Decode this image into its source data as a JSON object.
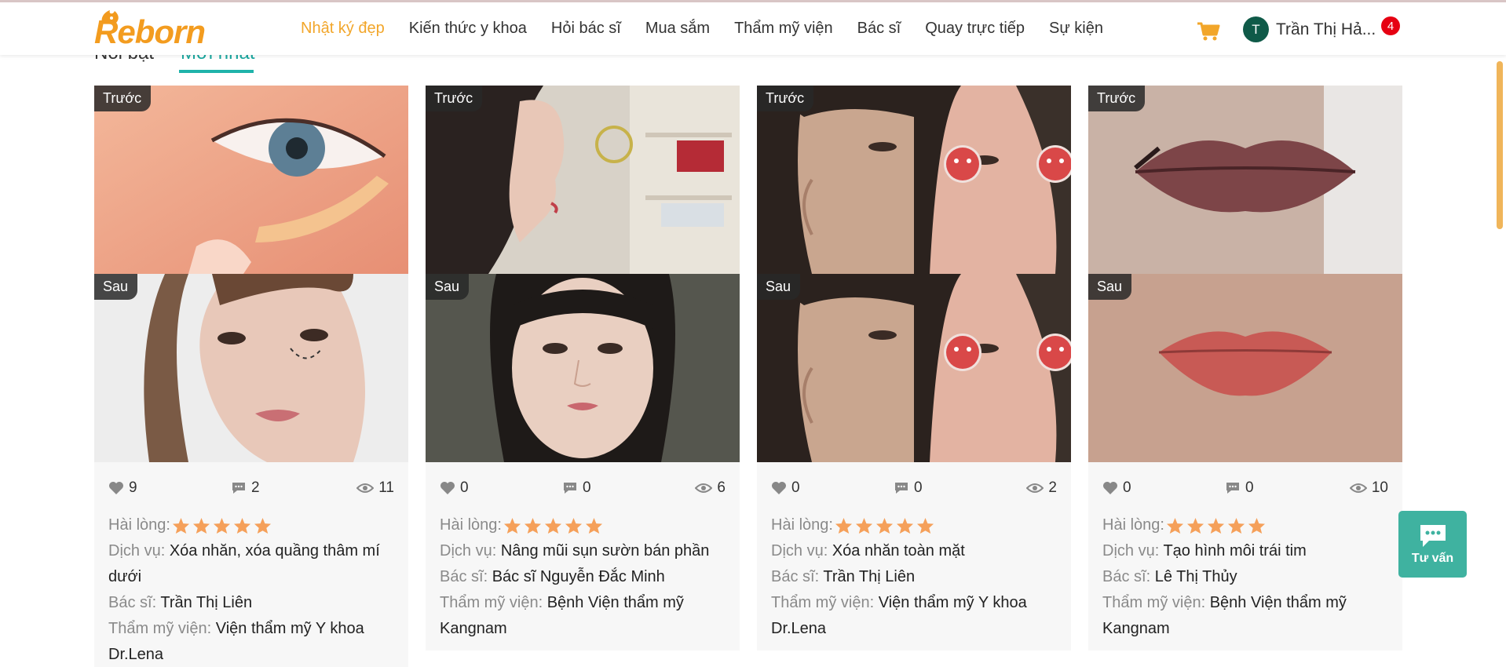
{
  "header": {
    "logo_text": "Reborn",
    "nav": [
      {
        "label": "Nhật ký đẹp",
        "active": true
      },
      {
        "label": "Kiến thức y khoa",
        "active": false
      },
      {
        "label": "Hỏi bác sĩ",
        "active": false
      },
      {
        "label": "Mua sắm",
        "active": false
      },
      {
        "label": "Thẩm mỹ viện",
        "active": false
      },
      {
        "label": "Bác sĩ",
        "active": false
      },
      {
        "label": "Quay trực tiếp",
        "active": false
      },
      {
        "label": "Sự kiện",
        "active": false
      }
    ],
    "cart_icon": "cart-icon",
    "user": {
      "initial": "T",
      "name": "Trần Thị Hả...",
      "notification_count": "4"
    }
  },
  "tabs": [
    {
      "label": "Nổi bật",
      "active": false
    },
    {
      "label": "Mới nhất",
      "active": true
    }
  ],
  "labels": {
    "before": "Trước",
    "after": "Sau",
    "satisfaction": "Hài lòng:",
    "service": "Dịch vụ:",
    "doctor": "Bác sĩ:",
    "clinic": "Thẩm mỹ viện:"
  },
  "cards": [
    {
      "likes": "9",
      "comments": "2",
      "views": "11",
      "rating": 5,
      "service": "Xóa nhăn, xóa quầng thâm mí dưới",
      "doctor": "Trần Thị Liên",
      "clinic": "Viện thẩm mỹ Y khoa Dr.Lena",
      "before_image": "eye-concealer-photo",
      "after_image": "woman-face-photo"
    },
    {
      "likes": "0",
      "comments": "0",
      "views": "6",
      "rating": 5,
      "service": "Nâng mũi sụn sườn bán phần",
      "doctor": "Bác sĩ Nguyễn Đắc Minh",
      "clinic": "Bệnh Viện thẩm mỹ Kangnam",
      "before_image": "side-profile-photo",
      "after_image": "front-face-photo"
    },
    {
      "likes": "0",
      "comments": "0",
      "views": "2",
      "rating": 5,
      "service": "Xóa nhăn toàn mặt",
      "doctor": "Trần Thị Liên",
      "clinic": "Viện thẩm mỹ Y khoa Dr.Lena",
      "before_image": "face-halves-photo",
      "after_image": "face-halves-photo"
    },
    {
      "likes": "0",
      "comments": "0",
      "views": "10",
      "rating": 5,
      "service": "Tạo hình môi trái tim",
      "doctor": "Lê Thị Thủy",
      "clinic": "Bệnh Viện thẩm mỹ Kangnam",
      "before_image": "lips-before-photo",
      "after_image": "lips-after-photo"
    }
  ],
  "consult": {
    "label": "Tư vấn",
    "icon": "chat-icon"
  },
  "colors": {
    "accent": "#f2a62a",
    "teal": "#1fb3aa",
    "star": "#f5a05a",
    "badge": "#e60012"
  }
}
